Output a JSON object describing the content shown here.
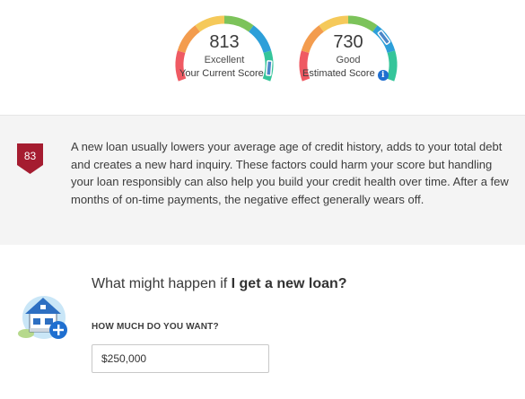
{
  "current_score": {
    "value": "813",
    "rating": "Excellent",
    "label": "Your Current Score",
    "fraction": 0.93
  },
  "estimated_score": {
    "value": "730",
    "rating": "Good",
    "label": "Estimated Score",
    "fraction": 0.74,
    "info_icon": "info-icon"
  },
  "gauge_colors": [
    "#ef5a63",
    "#f39c4e",
    "#f5c95a",
    "#7cc35a",
    "#2d9fd9",
    "#35c59a"
  ],
  "impact": {
    "badge_value": "83",
    "badge_color": "#a51c30",
    "text": "A new loan usually lowers your average age of credit history, adds to your total debt and creates a new hard inquiry. These factors could harm your score but handling your loan responsibly can also help you build your credit health over time. After a few months of on-time payments, the negative effect generally wears off."
  },
  "whatif": {
    "question_prefix": "What might happen if ",
    "question_emphasis": "I get a new loan?",
    "amount_label": "HOW MUCH DO YOU WANT?",
    "amount_value": "$250,000",
    "illustration_icon": "house-plus-icon"
  }
}
